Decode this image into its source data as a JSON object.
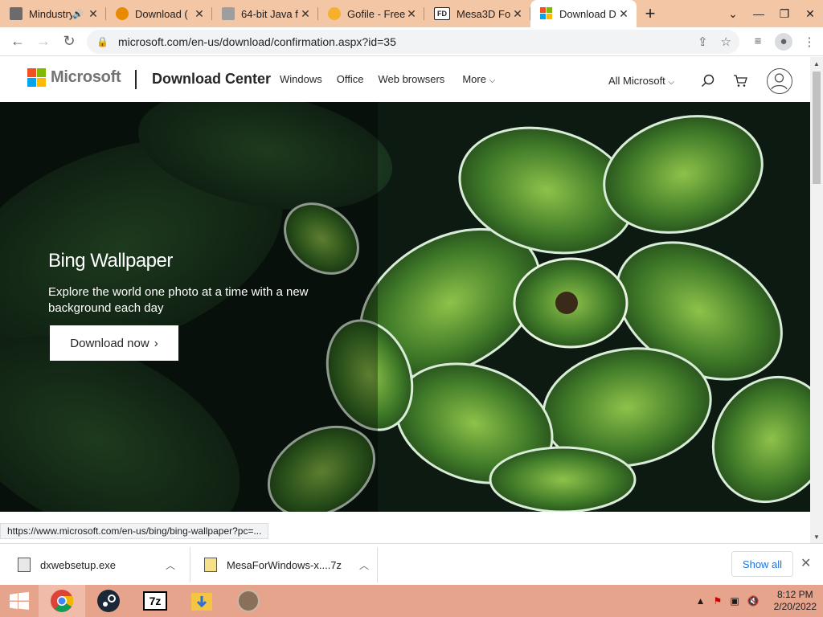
{
  "browser": {
    "tabs": [
      {
        "title": "Mindustry",
        "fav_color": "#6b6b6b",
        "extra": "🔊"
      },
      {
        "title": "Download (",
        "fav_color": "#e88a00"
      },
      {
        "title": "64-bit Java f",
        "fav_color": "#9e9e9e"
      },
      {
        "title": "Gofile - Free",
        "fav_color": "#f5b02e"
      },
      {
        "title": "Mesa3D For",
        "fav_color": "#202020",
        "fav_text": "FD"
      },
      {
        "title": "Download D",
        "fav_color": "#f25022",
        "active": true
      }
    ],
    "new_tab": "+",
    "url": "microsoft.com/en-us/download/confirmation.aspx?id=35",
    "status_url": "https://www.microsoft.com/en-us/bing/bing-wallpaper?pc=..."
  },
  "site": {
    "brand": "Microsoft",
    "section": "Download Center",
    "nav": [
      "Windows",
      "Office",
      "Web browsers"
    ],
    "more": "More",
    "all_microsoft": "All Microsoft"
  },
  "hero": {
    "title": "Bing Wallpaper",
    "description": "Explore the world one photo at a time with a new background each day",
    "button": "Download now",
    "bg_color": "#0d1a12",
    "leaf_color": "#4f8a2d"
  },
  "downloads": {
    "items": [
      "dxwebsetup.exe",
      "MesaForWindows-x....7z"
    ],
    "show_all": "Show all"
  },
  "taskbar": {
    "time": "8:12 PM",
    "date": "2/20/2022",
    "apps": [
      "chrome-icon",
      "steam-icon",
      "7zip-icon",
      "folder-icon",
      "app-icon"
    ]
  },
  "colors": {
    "tabstrip": "#f3c6a6",
    "taskbar": "#e7a48d",
    "link_blue": "#1a73e8"
  }
}
